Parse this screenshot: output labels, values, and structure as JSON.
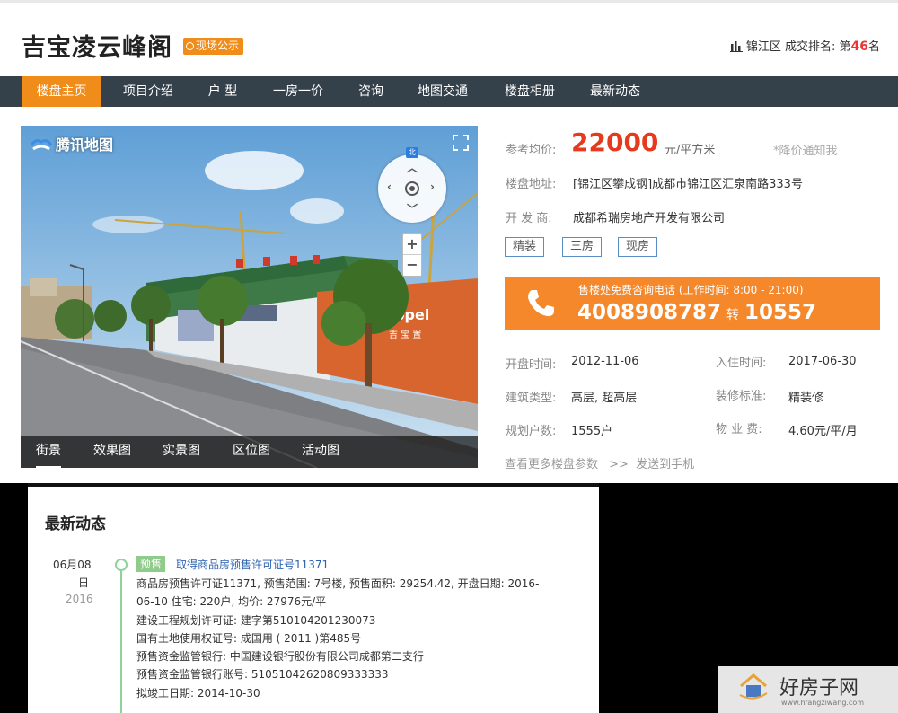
{
  "header": {
    "title": "吉宝凌云峰阁",
    "live_badge": "现场公示",
    "rank_prefix": "锦江区 成交排名: 第",
    "rank_num": "46",
    "rank_suffix": "名"
  },
  "nav": {
    "items": [
      "楼盘主页",
      "项目介绍",
      "户 型",
      "一房一价",
      "咨询",
      "地图交通",
      "楼盘相册",
      "最新动态"
    ],
    "active_index": 0
  },
  "map": {
    "logo": "腾讯地图",
    "compass_north": "北",
    "zoom_in": "+",
    "zoom_out": "−",
    "tabs": [
      "街景",
      "效果图",
      "实景图",
      "区位图",
      "活动图"
    ],
    "active_tab": 0,
    "sign_text": "keppel",
    "sign_sub": "吉 宝 置"
  },
  "info": {
    "price_label": "参考均价:",
    "price_value": "22000",
    "price_unit": "元/平方米",
    "price_notify": "*降价通知我",
    "address_label": "楼盘地址:",
    "address_value": "[锦江区攀成钢]成都市锦江区汇泉南路333号",
    "developer_label": "开 发 商:",
    "developer_value": "成都希瑞房地产开发有限公司",
    "tags": [
      "精装",
      "三房",
      "现房"
    ],
    "phone_hint": "售楼处免费咨询电话 (工作时间: 8:00 - 21:00)",
    "phone_main": "4008908787",
    "phone_zhuan": "转",
    "phone_ext": "10557",
    "open_label": "开盘时间:",
    "open_value": "2012-11-06",
    "checkin_label": "入住时间:",
    "checkin_value": "2017-06-30",
    "type_label": "建筑类型:",
    "type_value": "高层, 超高层",
    "decor_label": "装修标准:",
    "decor_value": "精装修",
    "units_label": "规划户数:",
    "units_value": "1555户",
    "fee_label": "物 业 费:",
    "fee_value": "4.60元/平/月",
    "more_link": "查看更多楼盘参数",
    "send_link": "发送到手机"
  },
  "dynamics": {
    "title": "最新动态",
    "date_md": "06月08",
    "date_d": "日",
    "date_y": "2016",
    "tag": "预售",
    "link": "取得商品房预售许可证号11371",
    "lines": [
      "商品房预售许可证11371, 预售范围: 7号楼, 预售面积: 29254.42, 开盘日期: 2016-",
      "06-10 住宅: 220户, 均价: 27976元/平",
      "建设工程规划许可证: 建字第510104201230073",
      "国有土地使用权证号: 成国用 ( 2011 )第485号",
      "预售资金监管银行: 中国建设银行股份有限公司成都第二支行",
      "预售资金监管银行账号: 51051042620809333333",
      "拟竣工日期: 2014-10-30"
    ]
  },
  "watermark": {
    "text": "好房子网",
    "url": "www.hfangziwang.com"
  },
  "colors": {
    "accent": "#f08c1a",
    "nav_bg": "#34404a",
    "price": "#e63a1e",
    "phone_box": "#f5882a"
  }
}
